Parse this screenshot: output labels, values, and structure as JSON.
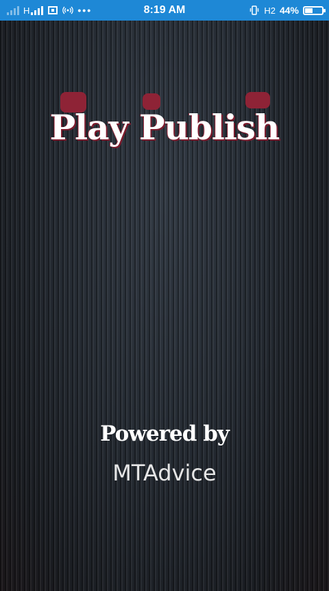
{
  "status_bar": {
    "network_type": "H",
    "time": "8:19 AM",
    "data_type": "H2",
    "battery": "44%",
    "battery_level": 0.44,
    "color": "#1e88d6"
  },
  "splash": {
    "title": "Play Publish",
    "powered_by": "Powered by",
    "company": "MTAdvice"
  },
  "colors": {
    "accent": "#8e2336",
    "background": "#222830"
  }
}
